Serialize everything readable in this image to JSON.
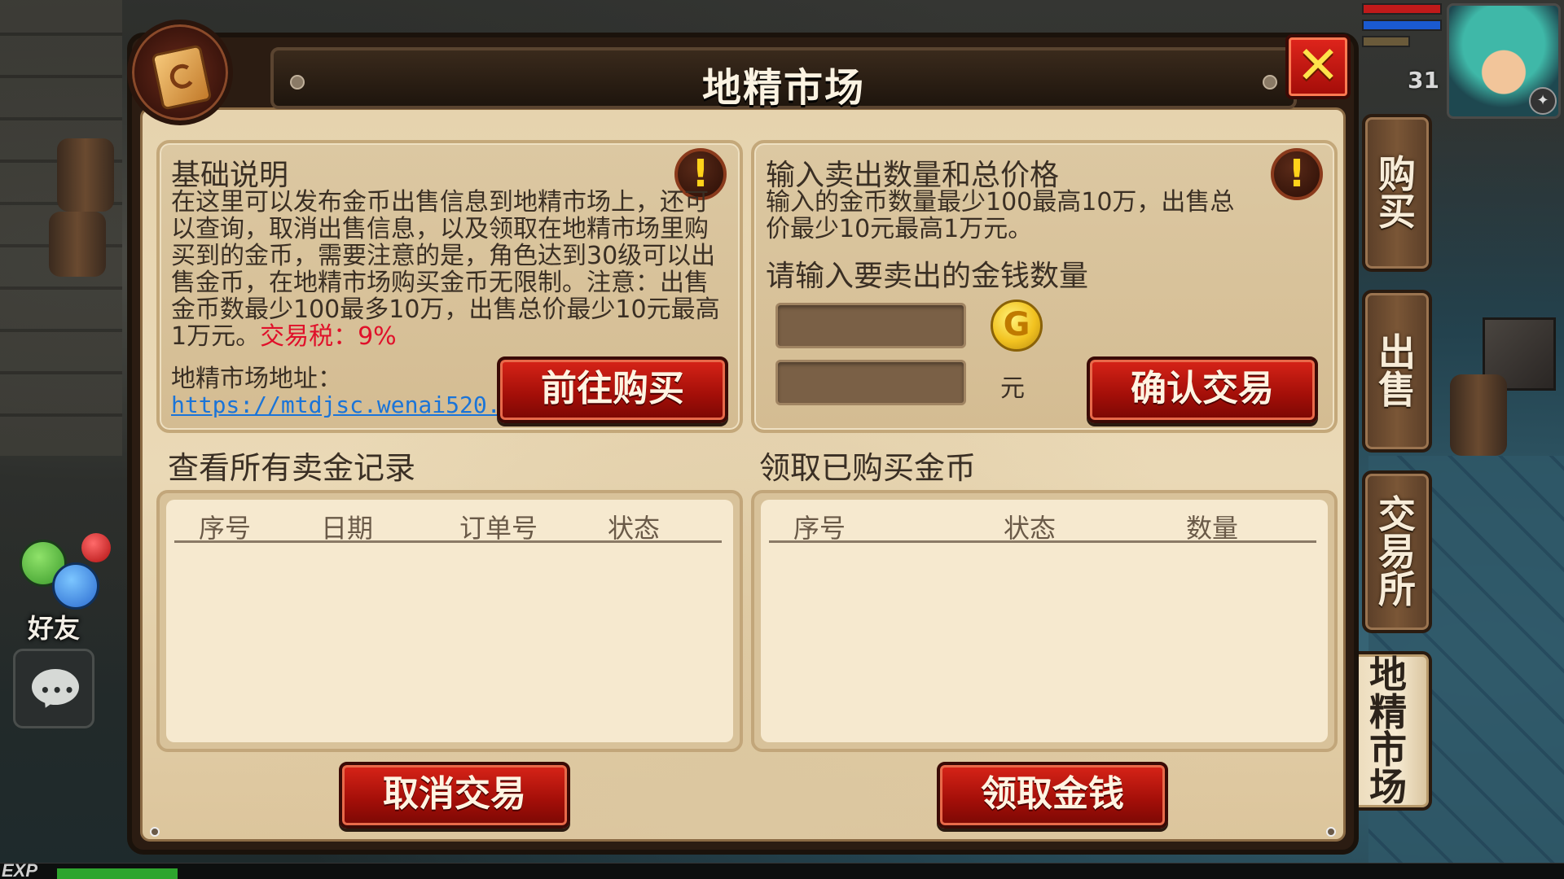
{
  "window": {
    "title": "地精市场"
  },
  "info_box": {
    "title": "基础说明",
    "body": "在这里可以发布金币出售信息到地精市场上，还可以查询，取消出售信息，以及领取在地精市场里购买到的金币，需要注意的是，角色达到30级可以出售金币，在地精市场购买金币无限制。注意：出售金币数最少100最多10万，出售总价最少10元最高1万元。",
    "tax_text": "交易税：9%",
    "address_label": "地精市场地址：",
    "address_link": "https://mtdjsc.wenai520.",
    "go_buy_button": "前往购买"
  },
  "sell_box": {
    "title": "输入卖出数量和总价格",
    "rule_text": "输入的金币数量最少100最高10万，出售总价最少10元最高1万元。",
    "prompt": "请输入要卖出的金钱数量",
    "amount_value": "",
    "price_value": "",
    "coin_symbol": "G",
    "currency_label": "元",
    "confirm_button": "确认交易"
  },
  "sell_records": {
    "title": "查看所有卖金记录",
    "columns": [
      "序号",
      "日期",
      "订单号",
      "状态"
    ],
    "rows": [],
    "cancel_button": "取消交易"
  },
  "purchased": {
    "title": "领取已购买金币",
    "columns": [
      "序号",
      "状态",
      "数量"
    ],
    "rows": [],
    "claim_button": "领取金钱"
  },
  "side_tabs": [
    {
      "label": [
        "购",
        "买"
      ],
      "active": false
    },
    {
      "label": [
        "出",
        "售"
      ],
      "active": false
    },
    {
      "label": [
        "交",
        "易",
        "所"
      ],
      "active": false
    },
    {
      "label": [
        "地",
        "精",
        "市",
        "场"
      ],
      "active": true
    }
  ],
  "hud": {
    "friend_label": "好友",
    "level": "31",
    "exp_label": "EXP",
    "exp_progress": 0.08,
    "close_symbol": "✕",
    "warning_symbol": "!"
  },
  "colors": {
    "primary_button": "#b81810",
    "tax_text": "#e0102a",
    "link": "#1a74d8",
    "panel_parchment": "#e6d3ae",
    "close_button": "#d82418"
  }
}
